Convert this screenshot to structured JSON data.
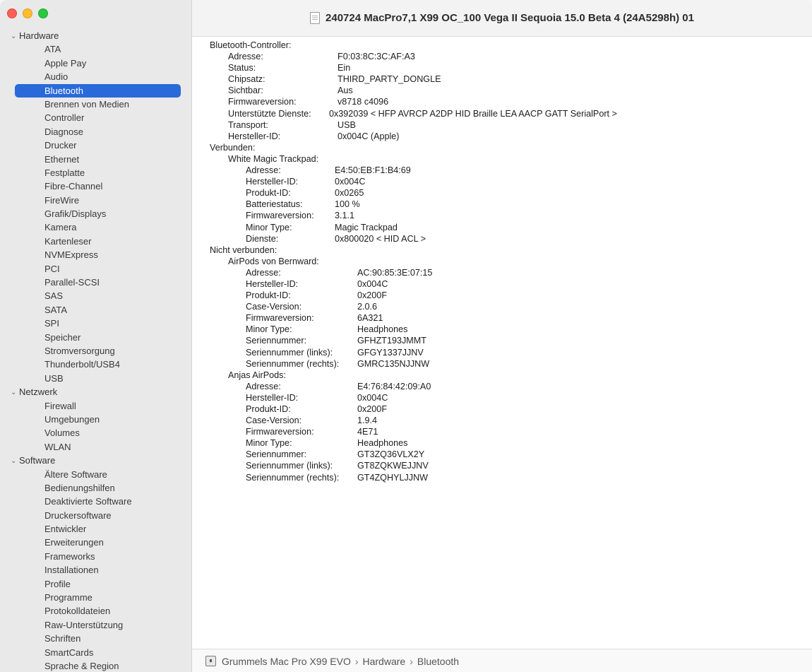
{
  "window": {
    "title": "240724 MacPro7,1 X99 OC_100 Vega II Sequoia 15.0 Beta 4 (24A5298h) 01"
  },
  "sidebar": {
    "sections": [
      {
        "label": "Hardware",
        "items": [
          "ATA",
          "Apple Pay",
          "Audio",
          "Bluetooth",
          "Brennen von Medien",
          "Controller",
          "Diagnose",
          "Drucker",
          "Ethernet",
          "Festplatte",
          "Fibre-Channel",
          "FireWire",
          "Grafik/Displays",
          "Kamera",
          "Kartenleser",
          "NVMExpress",
          "PCI",
          "Parallel-SCSI",
          "SAS",
          "SATA",
          "SPI",
          "Speicher",
          "Stromversorgung",
          "Thunderbolt/USB4",
          "USB"
        ]
      },
      {
        "label": "Netzwerk",
        "items": [
          "Firewall",
          "Umgebungen",
          "Volumes",
          "WLAN"
        ]
      },
      {
        "label": "Software",
        "items": [
          "Ältere Software",
          "Bedienungshilfen",
          "Deaktivierte Software",
          "Druckersoftware",
          "Entwickler",
          "Erweiterungen",
          "Frameworks",
          "Installationen",
          "Profile",
          "Programme",
          "Protokolldateien",
          "Raw-Unterstützung",
          "Schriften",
          "SmartCards",
          "Sprache & Region"
        ]
      }
    ],
    "selected": "Bluetooth"
  },
  "content": {
    "lines": [
      {
        "k": "Bluetooth-Controller:",
        "kx": 0
      },
      {
        "k": "Adresse:",
        "kx": 26,
        "v": "F0:03:8C:3C:AF:A3",
        "vx": 181
      },
      {
        "k": "Status:",
        "kx": 26,
        "v": "Ein",
        "vx": 181
      },
      {
        "k": "Chipsatz:",
        "kx": 26,
        "v": "THIRD_PARTY_DONGLE",
        "vx": 181
      },
      {
        "k": "Sichtbar:",
        "kx": 26,
        "v": "Aus",
        "vx": 181
      },
      {
        "k": "Firmwareversion:",
        "kx": 26,
        "v": "v8718 c4096",
        "vx": 181
      },
      {
        "k": "Unterstützte Dienste:",
        "kx": 26,
        "v": "0x392039 < HFP AVRCP A2DP HID Braille LEA AACP GATT SerialPort >",
        "vx": 169
      },
      {
        "k": "Transport:",
        "kx": 26,
        "v": "USB",
        "vx": 181
      },
      {
        "k": "Hersteller-ID:",
        "kx": 26,
        "v": "0x004C (Apple)",
        "vx": 181
      },
      {
        "k": "Verbunden:",
        "kx": 0
      },
      {
        "k": "White Magic Trackpad:",
        "kx": 26
      },
      {
        "k": "Adresse:",
        "kx": 51,
        "v": "E4:50:EB:F1:B4:69",
        "vx": 177
      },
      {
        "k": "Hersteller-ID:",
        "kx": 51,
        "v": "0x004C",
        "vx": 177
      },
      {
        "k": "Produkt-ID:",
        "kx": 51,
        "v": "0x0265",
        "vx": 177
      },
      {
        "k": "Batteriestatus:",
        "kx": 51,
        "v": "100 %",
        "vx": 177
      },
      {
        "k": "Firmwareversion:",
        "kx": 51,
        "v": "3.1.1",
        "vx": 177
      },
      {
        "k": "Minor Type:",
        "kx": 51,
        "v": "Magic Trackpad",
        "vx": 177
      },
      {
        "k": "Dienste:",
        "kx": 51,
        "v": "0x800020 < HID ACL >",
        "vx": 177
      },
      {
        "k": "Nicht verbunden:",
        "kx": 0
      },
      {
        "k": "AirPods von Bernward:",
        "kx": 26
      },
      {
        "k": "Adresse:",
        "kx": 51,
        "v": "AC:90:85:3E:07:15",
        "vx": 209
      },
      {
        "k": "Hersteller-ID:",
        "kx": 51,
        "v": "0x004C",
        "vx": 209
      },
      {
        "k": "Produkt-ID:",
        "kx": 51,
        "v": "0x200F",
        "vx": 209
      },
      {
        "k": "Case-Version:",
        "kx": 51,
        "v": "2.0.6",
        "vx": 209
      },
      {
        "k": "Firmwareversion:",
        "kx": 51,
        "v": "6A321",
        "vx": 209
      },
      {
        "k": "Minor Type:",
        "kx": 51,
        "v": "Headphones",
        "vx": 209
      },
      {
        "k": "Seriennummer:",
        "kx": 51,
        "v": "GFHZT193JMMT",
        "vx": 209
      },
      {
        "k": "Seriennummer (links):",
        "kx": 51,
        "v": "GFGY1337JJNV",
        "vx": 209
      },
      {
        "k": "Seriennummer (rechts):",
        "kx": 51,
        "v": "GMRC135NJJNW",
        "vx": 209
      },
      {
        "k": "Anjas AirPods:",
        "kx": 26
      },
      {
        "k": "Adresse:",
        "kx": 51,
        "v": "E4:76:84:42:09:A0",
        "vx": 209
      },
      {
        "k": "Hersteller-ID:",
        "kx": 51,
        "v": "0x004C",
        "vx": 209
      },
      {
        "k": "Produkt-ID:",
        "kx": 51,
        "v": "0x200F",
        "vx": 209
      },
      {
        "k": "Case-Version:",
        "kx": 51,
        "v": "1.9.4",
        "vx": 209
      },
      {
        "k": "Firmwareversion:",
        "kx": 51,
        "v": "4E71",
        "vx": 209
      },
      {
        "k": "Minor Type:",
        "kx": 51,
        "v": "Headphones",
        "vx": 209
      },
      {
        "k": "Seriennummer:",
        "kx": 51,
        "v": "GT3ZQ36VLX2Y",
        "vx": 209
      },
      {
        "k": "Seriennummer (links):",
        "kx": 51,
        "v": "GT8ZQKWEJJNV",
        "vx": 209
      },
      {
        "k": "Seriennummer (rechts):",
        "kx": 51,
        "v": "GT4ZQHYLJJNW",
        "vx": 209
      }
    ]
  },
  "pathbar": {
    "crumbs": [
      "Grummels Mac Pro X99 EVO",
      "Hardware",
      "Bluetooth"
    ],
    "separator": "›"
  }
}
